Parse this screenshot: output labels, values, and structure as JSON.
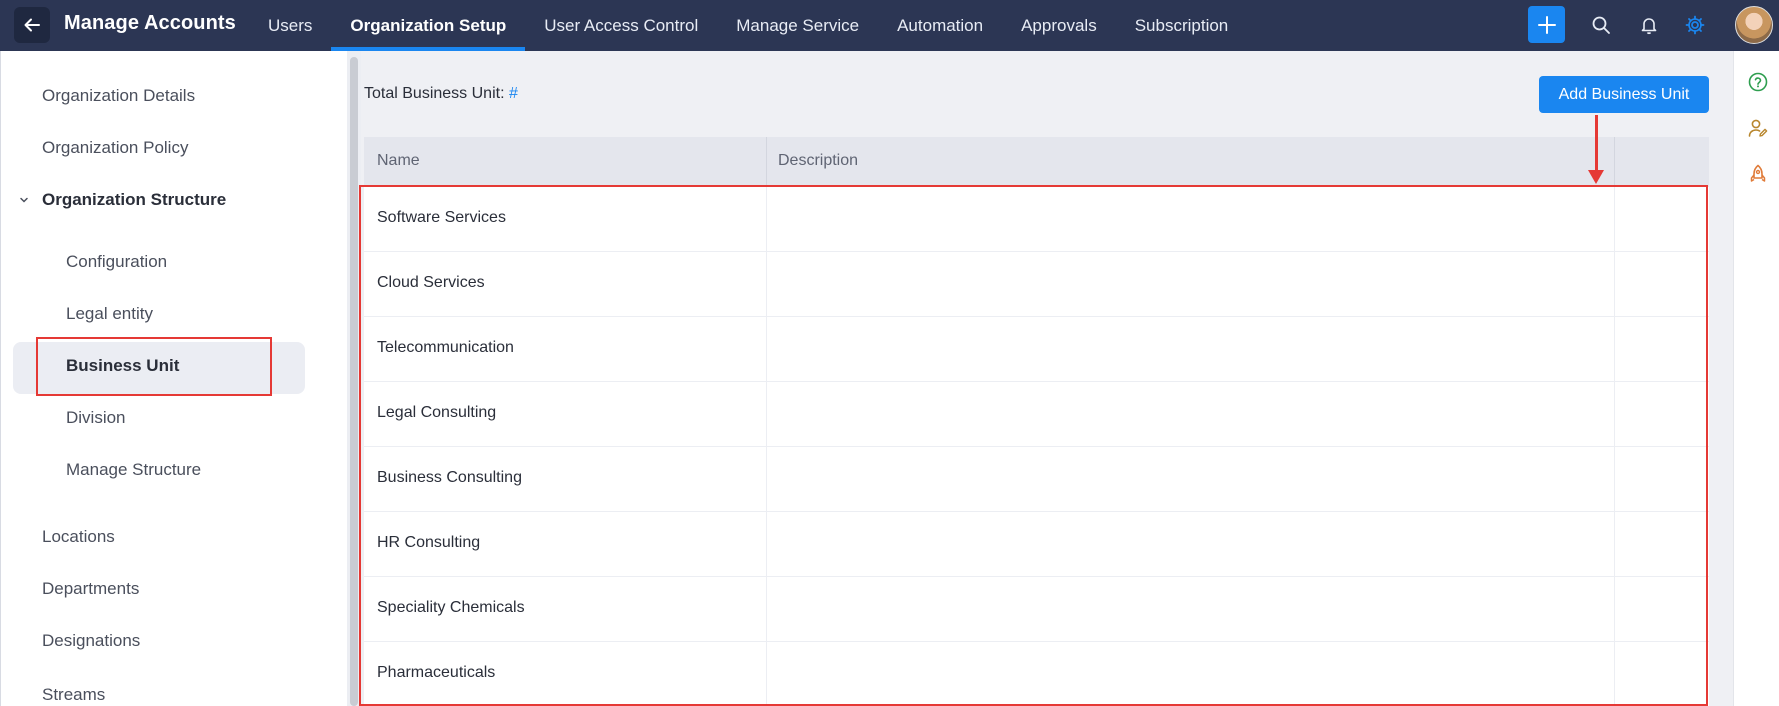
{
  "header": {
    "title": "Manage Accounts",
    "back_icon": "arrow-left-icon",
    "tabs": [
      {
        "label": "Users",
        "active": false
      },
      {
        "label": "Organization Setup",
        "active": true
      },
      {
        "label": "User Access Control",
        "active": false
      },
      {
        "label": "Manage Service",
        "active": false
      },
      {
        "label": "Automation",
        "active": false
      },
      {
        "label": "Approvals",
        "active": false
      },
      {
        "label": "Subscription",
        "active": false
      }
    ],
    "icons": [
      "plus-icon",
      "search-icon",
      "bell-icon",
      "gear-icon"
    ],
    "accent_color": "#1a86f0",
    "bar_color": "#2c3654"
  },
  "sidebar": {
    "items": [
      {
        "label": "Organization Details"
      },
      {
        "label": "Organization Policy"
      },
      {
        "label": "Organization Structure",
        "expanded": true
      },
      {
        "label": "Configuration"
      },
      {
        "label": "Legal entity"
      },
      {
        "label": "Business Unit",
        "selected": true
      },
      {
        "label": "Division"
      },
      {
        "label": "Manage Structure"
      },
      {
        "label": "Locations"
      },
      {
        "label": "Departments"
      },
      {
        "label": "Designations"
      },
      {
        "label": "Streams"
      }
    ]
  },
  "main": {
    "total_label": "Total Business Unit:",
    "total_value": "#",
    "add_button_label": "Add Business Unit",
    "table": {
      "columns": [
        "Name",
        "Description"
      ],
      "rows": [
        {
          "name": "Software Services",
          "description": ""
        },
        {
          "name": "Cloud Services",
          "description": ""
        },
        {
          "name": "Telecommunication",
          "description": ""
        },
        {
          "name": "Legal Consulting",
          "description": ""
        },
        {
          "name": "Business Consulting",
          "description": ""
        },
        {
          "name": "HR Consulting",
          "description": ""
        },
        {
          "name": "Speciality Chemicals",
          "description": ""
        },
        {
          "name": "Pharmaceuticals",
          "description": ""
        }
      ]
    }
  },
  "right_rail": {
    "icons": [
      "help-circle-icon",
      "user-edit-icon",
      "rocket-icon"
    ]
  },
  "annotations": {
    "highlight_color": "#e53935"
  }
}
